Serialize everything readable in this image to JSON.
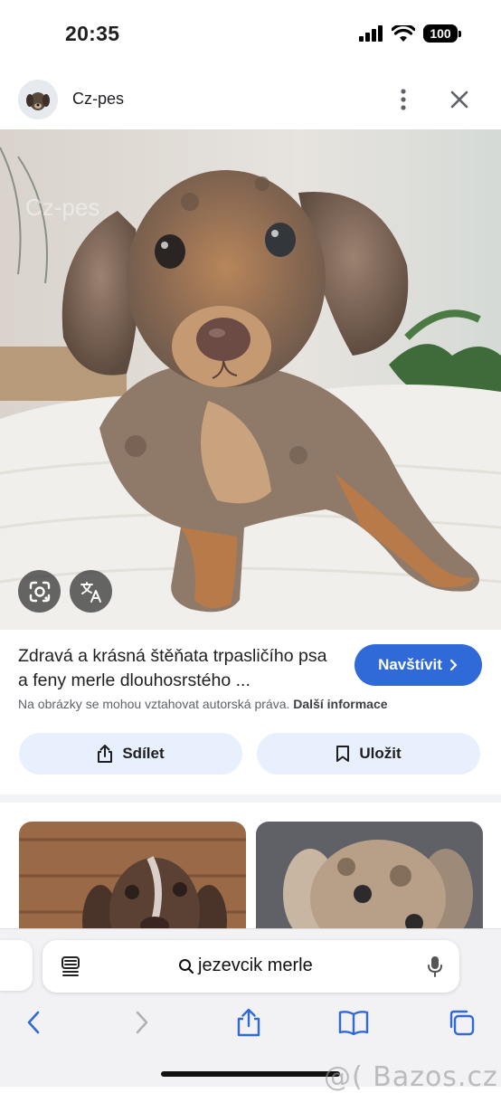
{
  "status_bar": {
    "time": "20:35",
    "battery": "100"
  },
  "header": {
    "source_name": "Cz-pes"
  },
  "image": {
    "alt": "Dachshund puppy merle",
    "watermark": "Cz-pes"
  },
  "result": {
    "title": "Zdravá a krásná štěňata trpasličího psa a feny merle dlouhosrstého ...",
    "visit_label": "Navštívit",
    "copyright_text": "Na obrázky se mohou vztahovat autorská práva.",
    "more_info_label": "Další informace"
  },
  "actions": {
    "share_label": "Sdílet",
    "save_label": "Uložit"
  },
  "browser": {
    "search_query": "jezevcik merle"
  },
  "watermark": "@( Bazos.cz"
}
